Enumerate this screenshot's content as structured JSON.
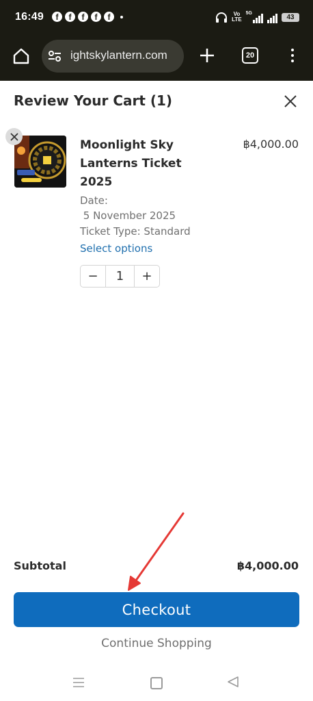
{
  "status_bar": {
    "time": "16:49",
    "notification_icons": [
      "facebook-icon",
      "facebook-icon",
      "facebook-icon",
      "facebook-icon",
      "facebook-icon"
    ],
    "volte_top": "Vo",
    "volte_bottom": "LTE",
    "network": "5G",
    "battery": "43"
  },
  "browser": {
    "url": "ightskylantern.com",
    "tab_count": "20"
  },
  "cart": {
    "title": "Review Your Cart (1)",
    "item": {
      "name": "Moonlight Sky Lanterns Ticket 2025",
      "price": "฿4,000.00",
      "date_label": "Date:",
      "date_value": " 5 November 2025",
      "ticket_type": "Ticket Type: Standard",
      "select_options": "Select options",
      "quantity": "1",
      "minus_label": "−",
      "plus_label": "+"
    },
    "subtotal_label": "Subtotal",
    "subtotal_value": "฿4,000.00",
    "checkout_label": "Checkout",
    "continue_label": "Continue Shopping"
  },
  "colors": {
    "browser_bar": "#1b1b13",
    "accent": "#0f6cbd",
    "link": "#1f6fae",
    "annotation": "#e53935"
  }
}
